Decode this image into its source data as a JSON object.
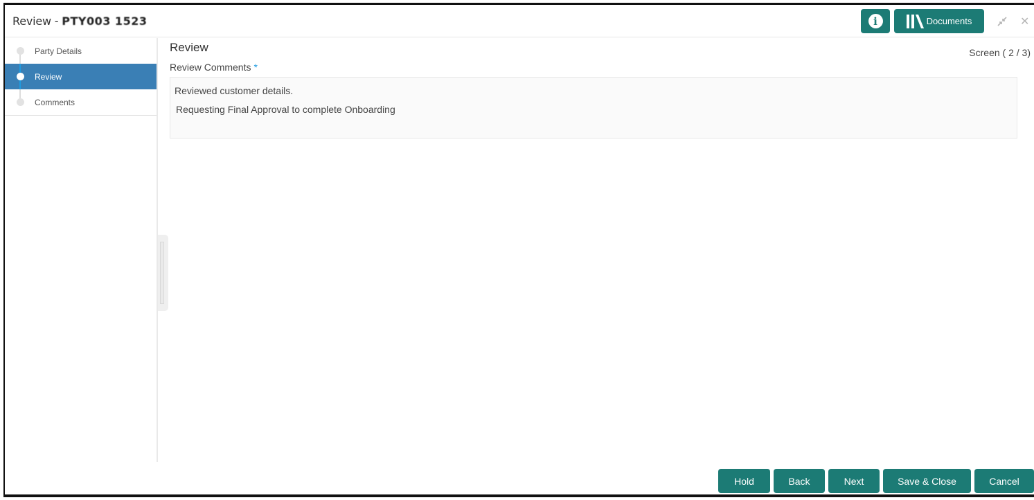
{
  "header": {
    "title_prefix": "Review - ",
    "title_id_masked": "PTY003 1523",
    "info_icon": "info-icon",
    "documents_label": "Documents",
    "documents_icon": "library-books-icon",
    "minimize_icon": "↙↗",
    "close_icon": "✕"
  },
  "sidebar": {
    "steps": [
      {
        "label": "Party Details",
        "state": "inactive"
      },
      {
        "label": "Review",
        "state": "active"
      },
      {
        "label": "Comments",
        "state": "inactive"
      }
    ]
  },
  "main": {
    "heading": "Review",
    "screen_indicator": "Screen ( 2 / 3)",
    "field_label": "Review Comments",
    "required_marker": "*",
    "comments": {
      "line1": "Reviewed customer details.",
      "line2": "Requesting Final Approval to complete Onboarding"
    }
  },
  "footer": {
    "hold": "Hold",
    "back": "Back",
    "next": "Next",
    "save_close": "Save & Close",
    "cancel": "Cancel"
  },
  "colors": {
    "primary_button": "#1c7b75",
    "active_step": "#3a7fb5",
    "required": "#1e9be0"
  }
}
